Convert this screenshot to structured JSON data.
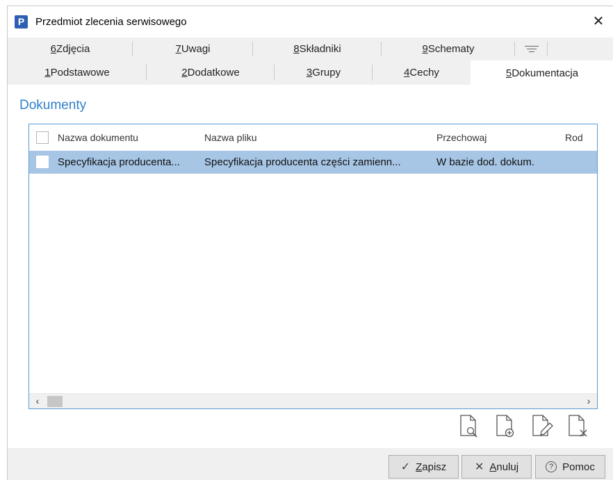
{
  "window": {
    "title": "Przedmiot zlecenia serwisowego",
    "app_icon_letter": "P",
    "close_glyph": "✕"
  },
  "tabs_row1": [
    {
      "key": "6",
      "label": " Zdjęcia"
    },
    {
      "key": "7",
      "label": " Uwagi"
    },
    {
      "key": "8",
      "label": " Składniki"
    },
    {
      "key": "9",
      "label": " Schematy"
    }
  ],
  "tabs_row2": [
    {
      "key": "1",
      "label": " Podstawowe"
    },
    {
      "key": "2",
      "label": " Dodatkowe"
    },
    {
      "key": "3",
      "label": " Grupy"
    },
    {
      "key": "4",
      "label": " Cechy"
    },
    {
      "key": "5",
      "label": " Dokumentacja",
      "active": true
    }
  ],
  "section": {
    "title": "Dokumenty"
  },
  "grid": {
    "columns": [
      "Nazwa dokumentu",
      "Nazwa pliku",
      "Przechowaj",
      "Rod"
    ],
    "rows": [
      {
        "nazwa_dokumentu": "Specyfikacja producenta...",
        "nazwa_pliku": "Specyfikacja producenta części zamienn...",
        "przechowaj": "W bazie dod. dokum.",
        "rod": "",
        "selected": true
      }
    ],
    "scroll_left": "‹",
    "scroll_right": "›"
  },
  "doc_icons": [
    "document-preview-icon",
    "document-add-icon",
    "document-edit-icon",
    "document-delete-icon"
  ],
  "buttons": {
    "save": {
      "icon": "✓",
      "ul": "Z",
      "rest": "apisz"
    },
    "cancel": {
      "icon": "✕",
      "ul": "A",
      "rest": "nuluj"
    },
    "help": {
      "icon": "?",
      "label": "Pomoc"
    }
  },
  "colors": {
    "accent": "#2f7fc8",
    "row_selected": "#a7c5e4",
    "grid_border": "#5b9bd5",
    "tab_bg": "#f0f0f0"
  }
}
